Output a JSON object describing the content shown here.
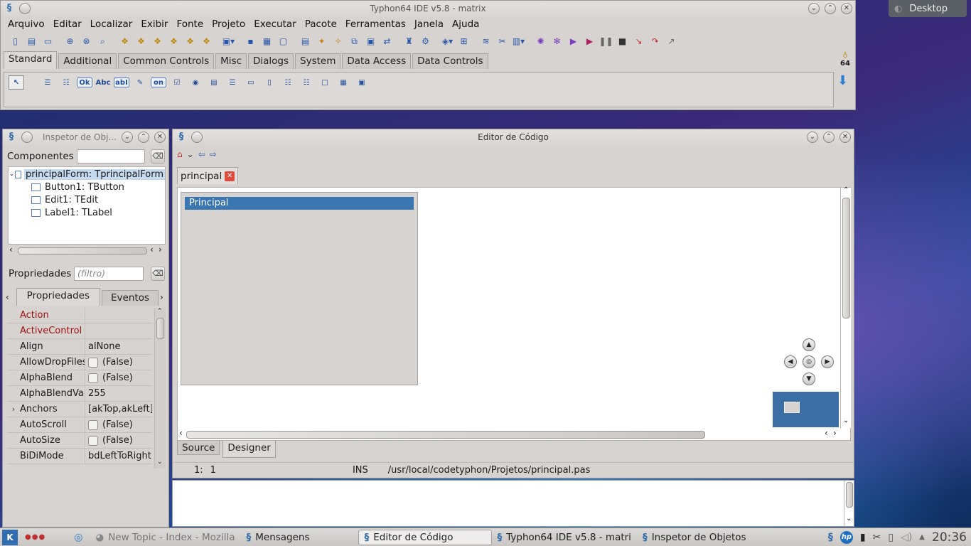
{
  "main_window": {
    "title": "Typhon64 IDE v5.8 - matrix",
    "menu": [
      "Arquivo",
      "Editar",
      "Localizar",
      "Exibir",
      "Fonte",
      "Projeto",
      "Executar",
      "Pacote",
      "Ferramentas",
      "Janela",
      "Ajuda"
    ],
    "palette_tabs": [
      "Standard",
      "Additional",
      "Common Controls",
      "Misc",
      "Dialogs",
      "System",
      "Data Access",
      "Data Controls"
    ],
    "palette_active": "Standard",
    "palette_icon_label_ok": "Ok",
    "palette_icon_label_abc": "Abc",
    "palette_icon_label_abl": "abI",
    "palette_icon_label_on": "on",
    "bits_label": "64"
  },
  "desktop_button": "Desktop",
  "inspector": {
    "title": "Inspetor de Obj...",
    "components_label": "Componentes",
    "tree": [
      "principalForm: TprincipalForm",
      "Button1: TButton",
      "Edit1: TEdit",
      "Label1: TLabel"
    ],
    "properties_label": "Propriedades",
    "filter_placeholder": "(filtro)",
    "tabs": [
      "Propriedades",
      "Eventos"
    ],
    "props": [
      {
        "name": "Action",
        "value": "",
        "red": true
      },
      {
        "name": "ActiveControl",
        "value": "",
        "red": true
      },
      {
        "name": "Align",
        "value": "alNone"
      },
      {
        "name": "AllowDropFiles",
        "value": "(False)",
        "check": true
      },
      {
        "name": "AlphaBlend",
        "value": "(False)",
        "check": true
      },
      {
        "name": "AlphaBlendVal",
        "value": "255"
      },
      {
        "name": "Anchors",
        "value": "[akTop,akLeft]",
        "expand": true
      },
      {
        "name": "AutoScroll",
        "value": "(False)",
        "check": true
      },
      {
        "name": "AutoSize",
        "value": "(False)",
        "check": true
      },
      {
        "name": "BiDiMode",
        "value": "bdLeftToRight"
      }
    ]
  },
  "editor": {
    "title": "Editor de Código",
    "file_tab": "principal",
    "form_caption": "Principal",
    "bottom_tabs": [
      "Source",
      "Designer"
    ],
    "status": {
      "line": "1:",
      "col": "1",
      "mode": "INS",
      "path": "/usr/local/codetyphon/Projetos/principal.pas"
    }
  },
  "taskbar": {
    "items": [
      "New Topic - Index - Mozilla",
      "Mensagens",
      "Editor de Código",
      "Typhon64 IDE v5.8 - matri",
      "Inspetor de Objetos"
    ],
    "clock": "20:36"
  },
  "colors": {
    "selection": "#3a76b0",
    "red_prop": "#a01010"
  }
}
